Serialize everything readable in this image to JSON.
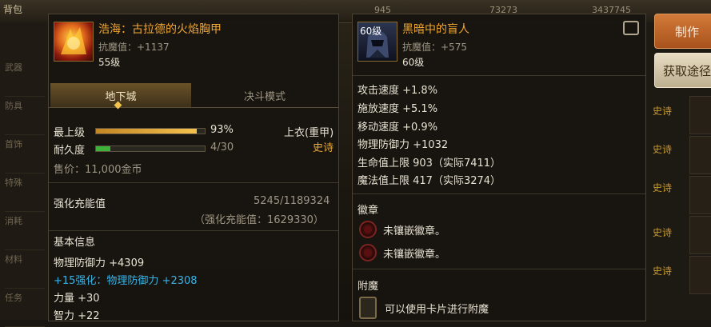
{
  "background": {
    "topbar": {
      "tab_label": "背包",
      "currency1": "945",
      "currency2": "73273",
      "currency3": "3437745"
    },
    "left_nav": [
      "武器",
      "防具",
      "首饰",
      "特殊",
      "消耗",
      "材料",
      "任务"
    ],
    "right_labels": [
      "史诗",
      "史诗",
      "史诗",
      "史诗",
      "史诗"
    ]
  },
  "buttons": {
    "make": "制作",
    "route": "获取途径"
  },
  "item1": {
    "name": "浩海：古拉德的火焰胸甲",
    "resist": "抗魔值：+1137",
    "level": "55级",
    "tabs": [
      "地下城",
      "决斗模式"
    ],
    "max_level_label": "最上级",
    "max_level_value": "93%",
    "max_level_fraction": 0.93,
    "durability_label": "耐久度",
    "durability_value": "4/30",
    "durability_fraction": 0.133,
    "type": "上衣(重甲)",
    "rarity": "史诗",
    "price": "售价：11,000金币",
    "enhance_label": "强化充能值",
    "enhance_value": "5245/1189324",
    "enhance_sub": "（强化充能值：1629330）",
    "basic_title": "基本信息",
    "stats": [
      {
        "text": "物理防御力 +4309",
        "color": "white"
      },
      {
        "text": "+15强化：物理防御力 +2308",
        "color": "cyan"
      },
      {
        "text": "力量 +30",
        "color": "white"
      },
      {
        "text": "智力 +22",
        "color": "white"
      }
    ]
  },
  "item2": {
    "name": "黑暗中的盲人",
    "icon_level": "60级",
    "resist": "抗魔值：+575",
    "level": "60级",
    "stats": [
      "攻击速度 +1.8%",
      "施放速度 +5.1%",
      "移动速度 +0.9%",
      "物理防御力 +1032",
      "生命值上限 903（实际7411）",
      "魔法值上限 417（实际3274）"
    ],
    "emblem_title": "徽章",
    "emblems": [
      "未镶嵌徽章。",
      "未镶嵌徽章。"
    ],
    "enchant_title": "附魔",
    "enchant_text": "可以使用卡片进行附魔"
  },
  "colors": {
    "item_name": "#f0a630",
    "enhance_text": "#39b4e6",
    "rarity": "#e8a93a"
  }
}
